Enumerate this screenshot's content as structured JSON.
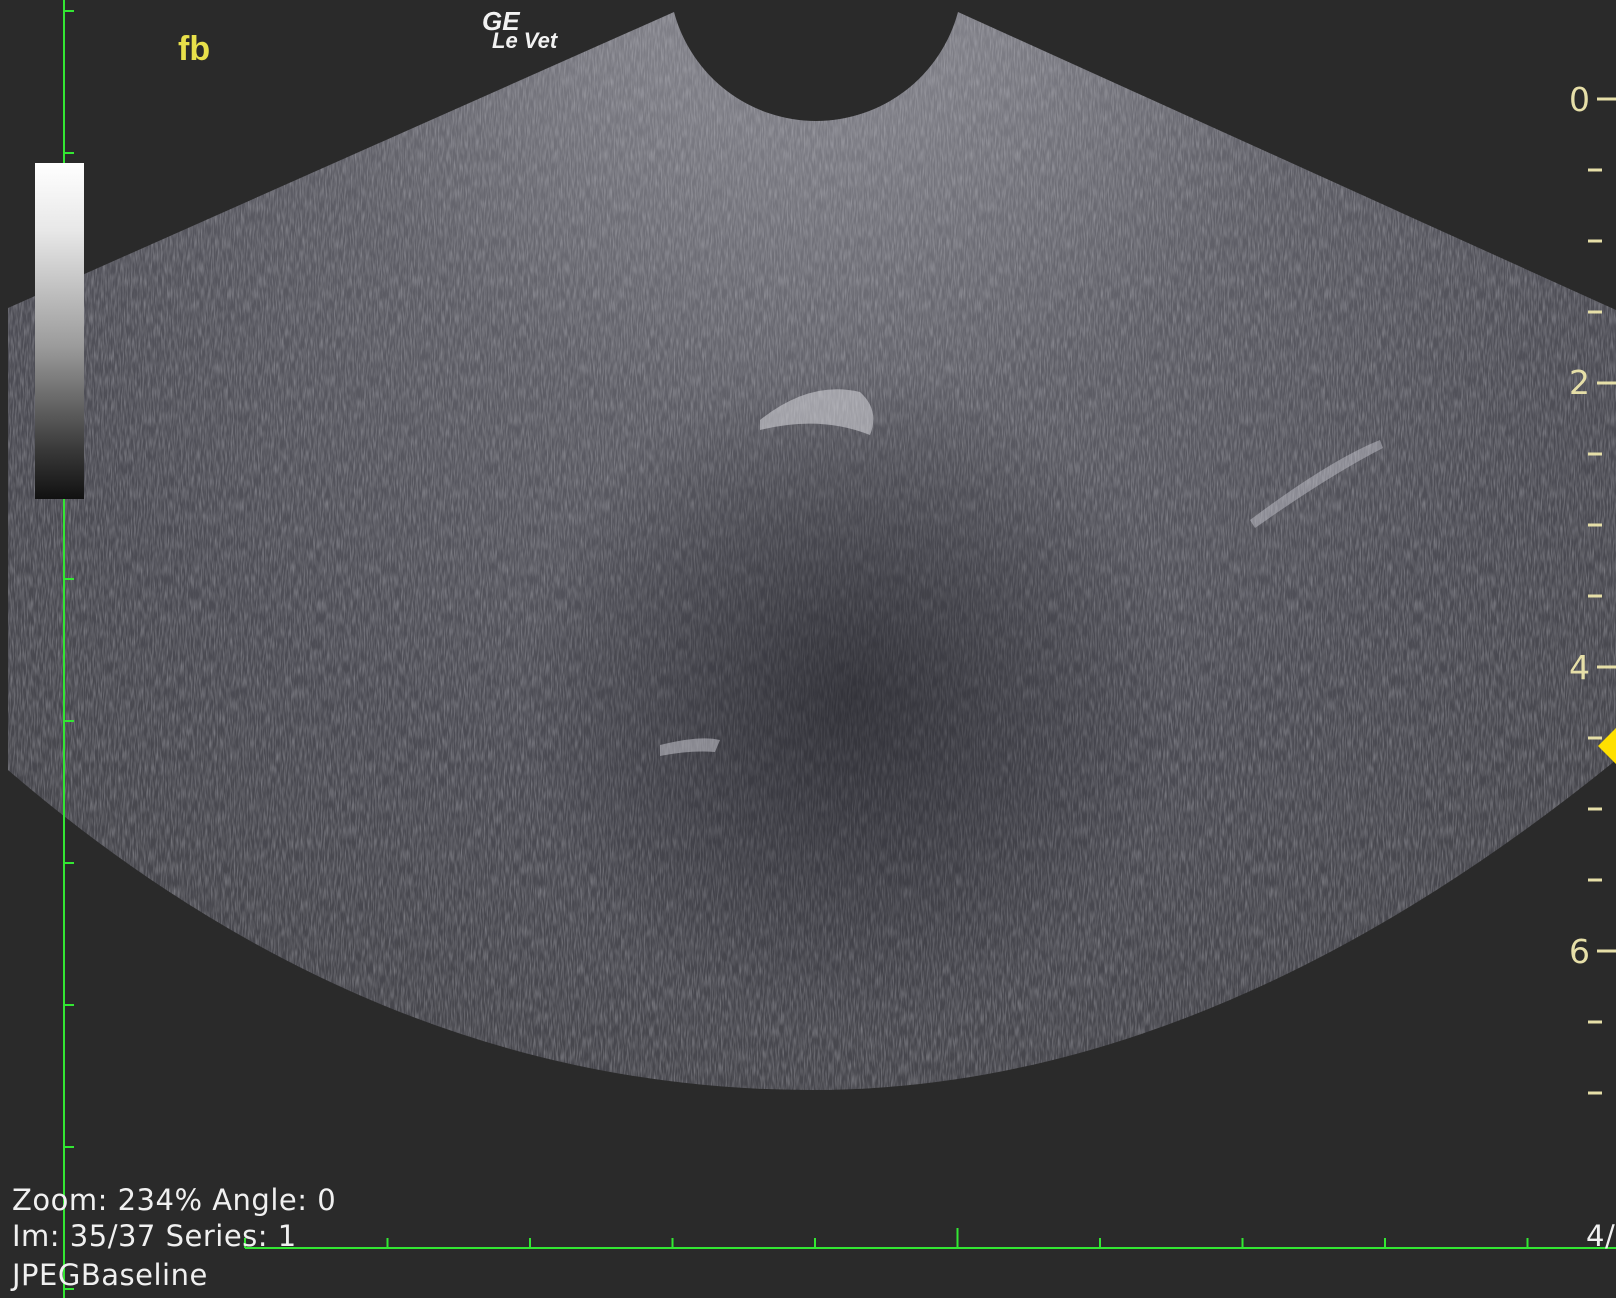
{
  "viewer": {
    "orientation_label": "fb",
    "logo": {
      "line1": "GE",
      "line2": "Le Vet"
    },
    "info": {
      "zoom_line": "Zoom: 234% Angle: 0",
      "image_line": "Im: 35/37  Series:  1",
      "compression": "JPEGBaseline"
    },
    "depth_scale": {
      "labels": [
        "0",
        "2",
        "4",
        "6"
      ],
      "marker_color": "#ffe000"
    },
    "frame_counter_fragment": "4/",
    "colors": {
      "background": "#2a2a2a",
      "ruler": "#33e633",
      "depth_text": "#e6dfa8",
      "orientation_text": "#e8e04a"
    },
    "icons": {
      "depth_focus_marker": "triangle-left-icon"
    }
  }
}
